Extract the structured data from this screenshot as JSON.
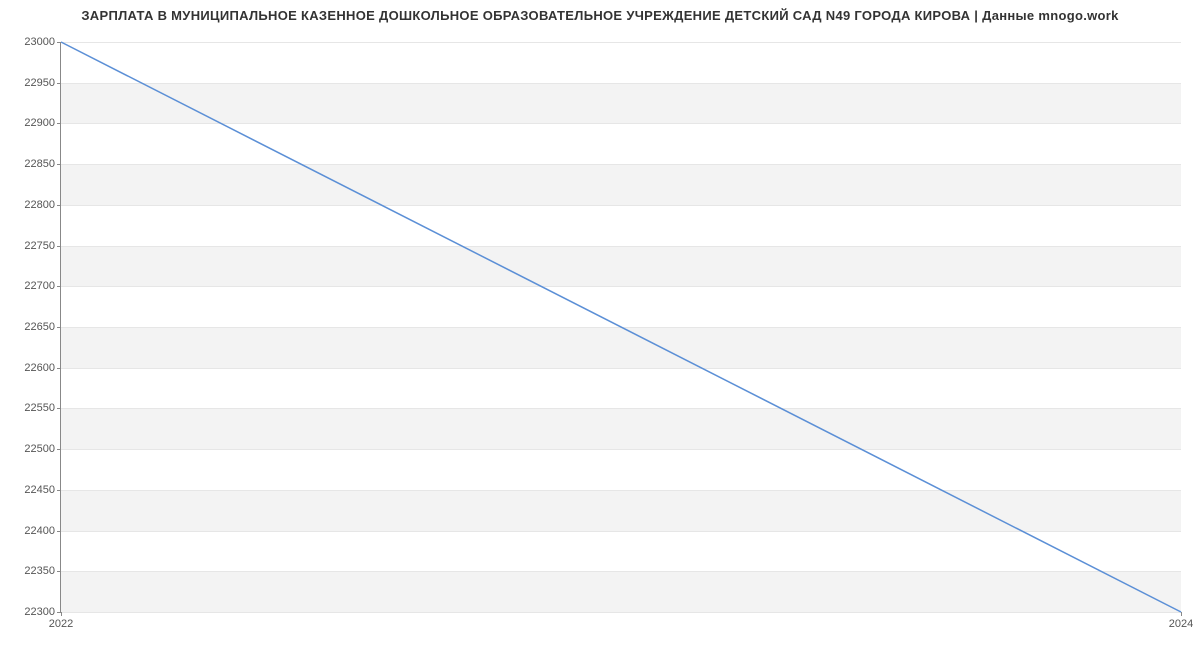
{
  "chart_data": {
    "type": "line",
    "title": "ЗАРПЛАТА В МУНИЦИПАЛЬНОЕ КАЗЕННОЕ ДОШКОЛЬНОЕ ОБРАЗОВАТЕЛЬНОЕ УЧРЕЖДЕНИЕ ДЕТСКИЙ САД N49 ГОРОДА КИРОВА | Данные mnogo.work",
    "x": [
      2022,
      2024
    ],
    "values": [
      23000,
      22300
    ],
    "xlabel": "",
    "ylabel": "",
    "x_ticks": [
      2022,
      2024
    ],
    "y_ticks": [
      22300,
      22350,
      22400,
      22450,
      22500,
      22550,
      22600,
      22650,
      22700,
      22750,
      22800,
      22850,
      22900,
      22950,
      23000
    ],
    "ylim": [
      22300,
      23000
    ],
    "xlim": [
      2022,
      2024
    ]
  }
}
